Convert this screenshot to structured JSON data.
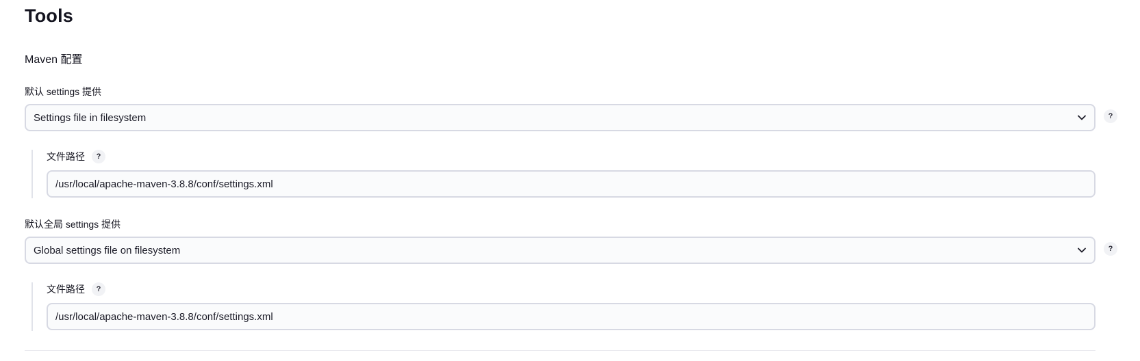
{
  "header": {
    "title": "Tools"
  },
  "maven_config": {
    "section_title": "Maven 配置",
    "default_settings": {
      "label": "默认 settings 提供",
      "selected": "Settings file in filesystem",
      "file_path_label": "文件路径",
      "file_path_value": "/usr/local/apache-maven-3.8.8/conf/settings.xml"
    },
    "default_global_settings": {
      "label": "默认全局 settings 提供",
      "selected": "Global settings file on filesystem",
      "file_path_label": "文件路径",
      "file_path_value": "/usr/local/apache-maven-3.8.8/conf/settings.xml"
    },
    "help_symbol": "?"
  },
  "icons": {
    "dropdown": "chevron-down-icon",
    "help": "help-icon"
  },
  "colors": {
    "border": "#d7d9e3",
    "field_bg": "#fafbfc",
    "help_bg": "#f1f2f5",
    "text": "#14141f"
  }
}
